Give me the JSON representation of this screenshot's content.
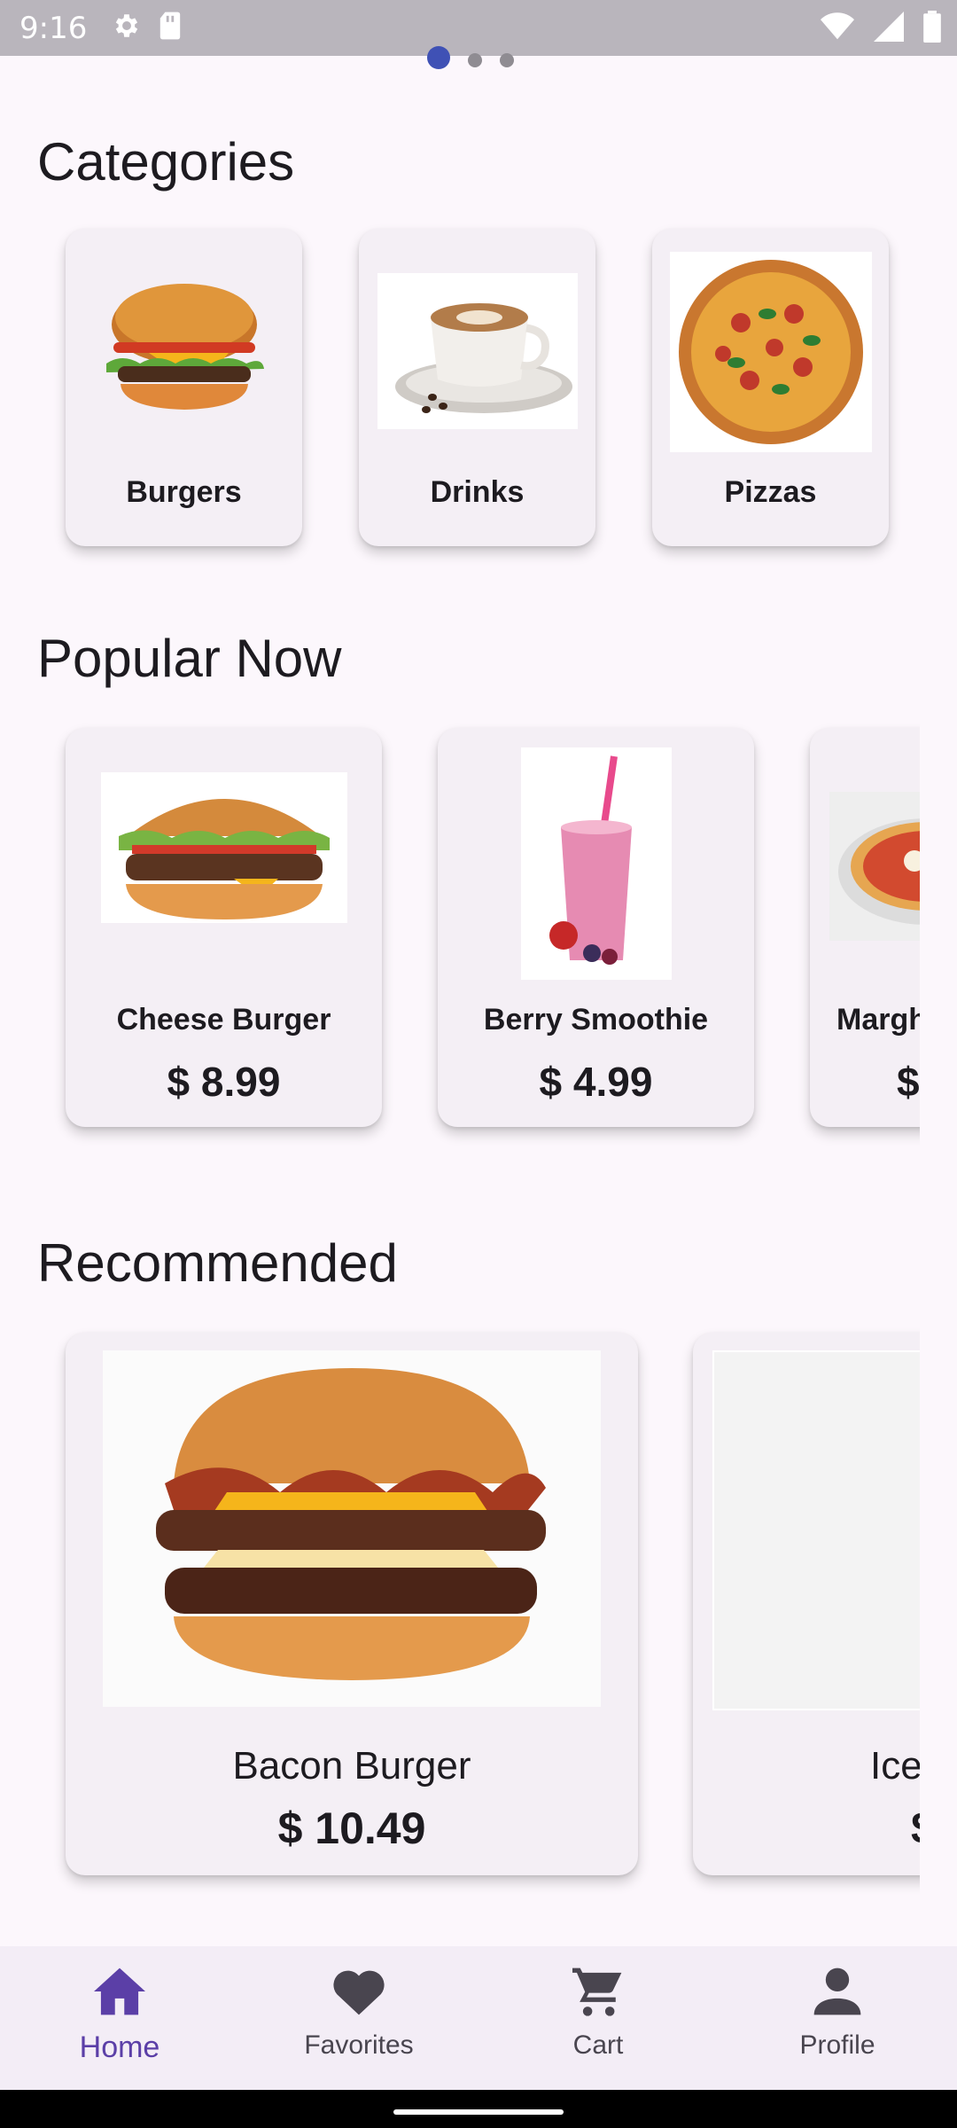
{
  "status_bar": {
    "time": "9:16"
  },
  "pager": {
    "pages": 3,
    "active_index": 0
  },
  "sections": {
    "categories_title": "Categories",
    "popular_title": "Popular Now",
    "recommended_title": "Recommended"
  },
  "categories": [
    {
      "label": "Burgers"
    },
    {
      "label": "Drinks"
    },
    {
      "label": "Pizzas"
    }
  ],
  "popular": [
    {
      "name": "Cheese Burger",
      "price": "$ 8.99"
    },
    {
      "name": "Berry Smoothie",
      "price": "$ 4.99"
    },
    {
      "name": "Margh",
      "price": "$"
    }
  ],
  "recommended": [
    {
      "name": "Bacon Burger",
      "price": "$ 10.49"
    },
    {
      "name": "Ice",
      "price": "$"
    }
  ],
  "bottom_nav": {
    "items": [
      {
        "label": "Home",
        "icon": "home-icon",
        "active": true
      },
      {
        "label": "Favorites",
        "icon": "heart-icon",
        "active": false
      },
      {
        "label": "Cart",
        "icon": "cart-icon",
        "active": false
      },
      {
        "label": "Profile",
        "icon": "person-icon",
        "active": false
      }
    ]
  },
  "colors": {
    "accent": "#5b3fa7",
    "pager_active": "#3f51b5",
    "background": "#fcf7fc",
    "card": "#f4eff5"
  }
}
